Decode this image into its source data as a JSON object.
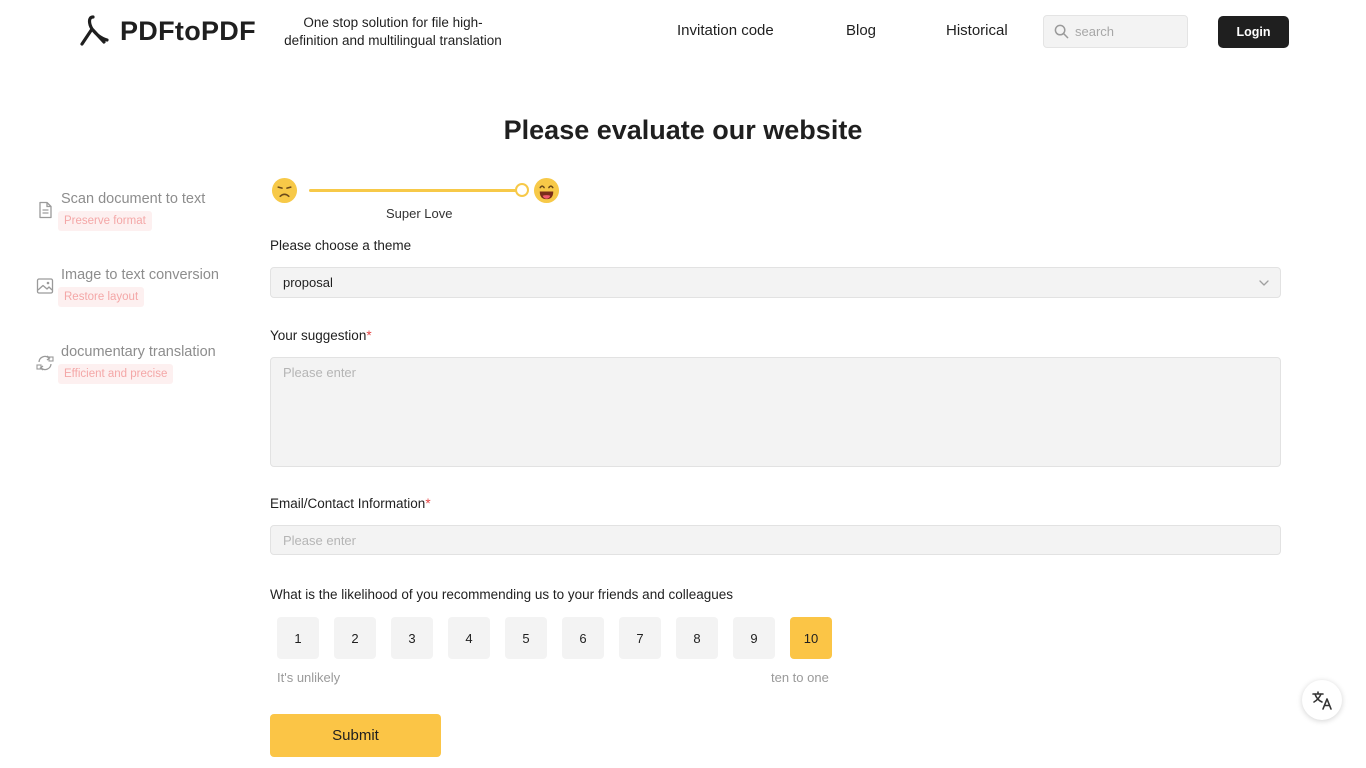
{
  "header": {
    "logo_text": "PDFtoPDF",
    "tagline": "One stop solution for file high-definition and multilingual translation",
    "nav": [
      {
        "label": "Invitation code",
        "icon": null
      },
      {
        "label": "Blog",
        "icon": null
      },
      {
        "label": "Historical",
        "icon": null
      }
    ],
    "search": {
      "placeholder": "search",
      "icon": "search-icon"
    },
    "login_label": "Login"
  },
  "sidebar": {
    "items": [
      {
        "title": "Scan document to text",
        "badge": "Preserve format",
        "icon": "document-icon"
      },
      {
        "title": "Image to text conversion",
        "badge": "Restore layout",
        "icon": "image-icon"
      },
      {
        "title": "documentary translation",
        "badge": "Efficient and precise",
        "icon": "translate-cycle-icon"
      }
    ]
  },
  "main": {
    "title": "Please evaluate our website",
    "rating": {
      "label": "Super Love",
      "level": 1.0,
      "left_icon": "unhappy-face-icon",
      "right_icon": "laughing-face-icon"
    },
    "theme": {
      "label": "Please choose a theme",
      "value": "proposal"
    },
    "suggestion": {
      "label": "Your suggestion",
      "required_mark": "*",
      "placeholder": "Please enter"
    },
    "email": {
      "label": "Email/Contact Information",
      "required_mark": "*",
      "placeholder": "Please enter"
    },
    "recommend": {
      "question": "What is the likelihood of you recommending us to your friends and colleagues",
      "scores": [
        "1",
        "2",
        "3",
        "4",
        "5",
        "6",
        "7",
        "8",
        "9",
        "10"
      ],
      "selected": "10",
      "low_label": "It's unlikely",
      "high_label": "ten to one"
    },
    "submit_label": "Submit"
  },
  "colors": {
    "accent": "#fbc546",
    "dark": "#1f1f1f",
    "required": "#e54848",
    "badge_bg": "#fdf0f0",
    "badge_text": "#f4a7a7"
  },
  "floating": {
    "icon": "translate-icon"
  }
}
